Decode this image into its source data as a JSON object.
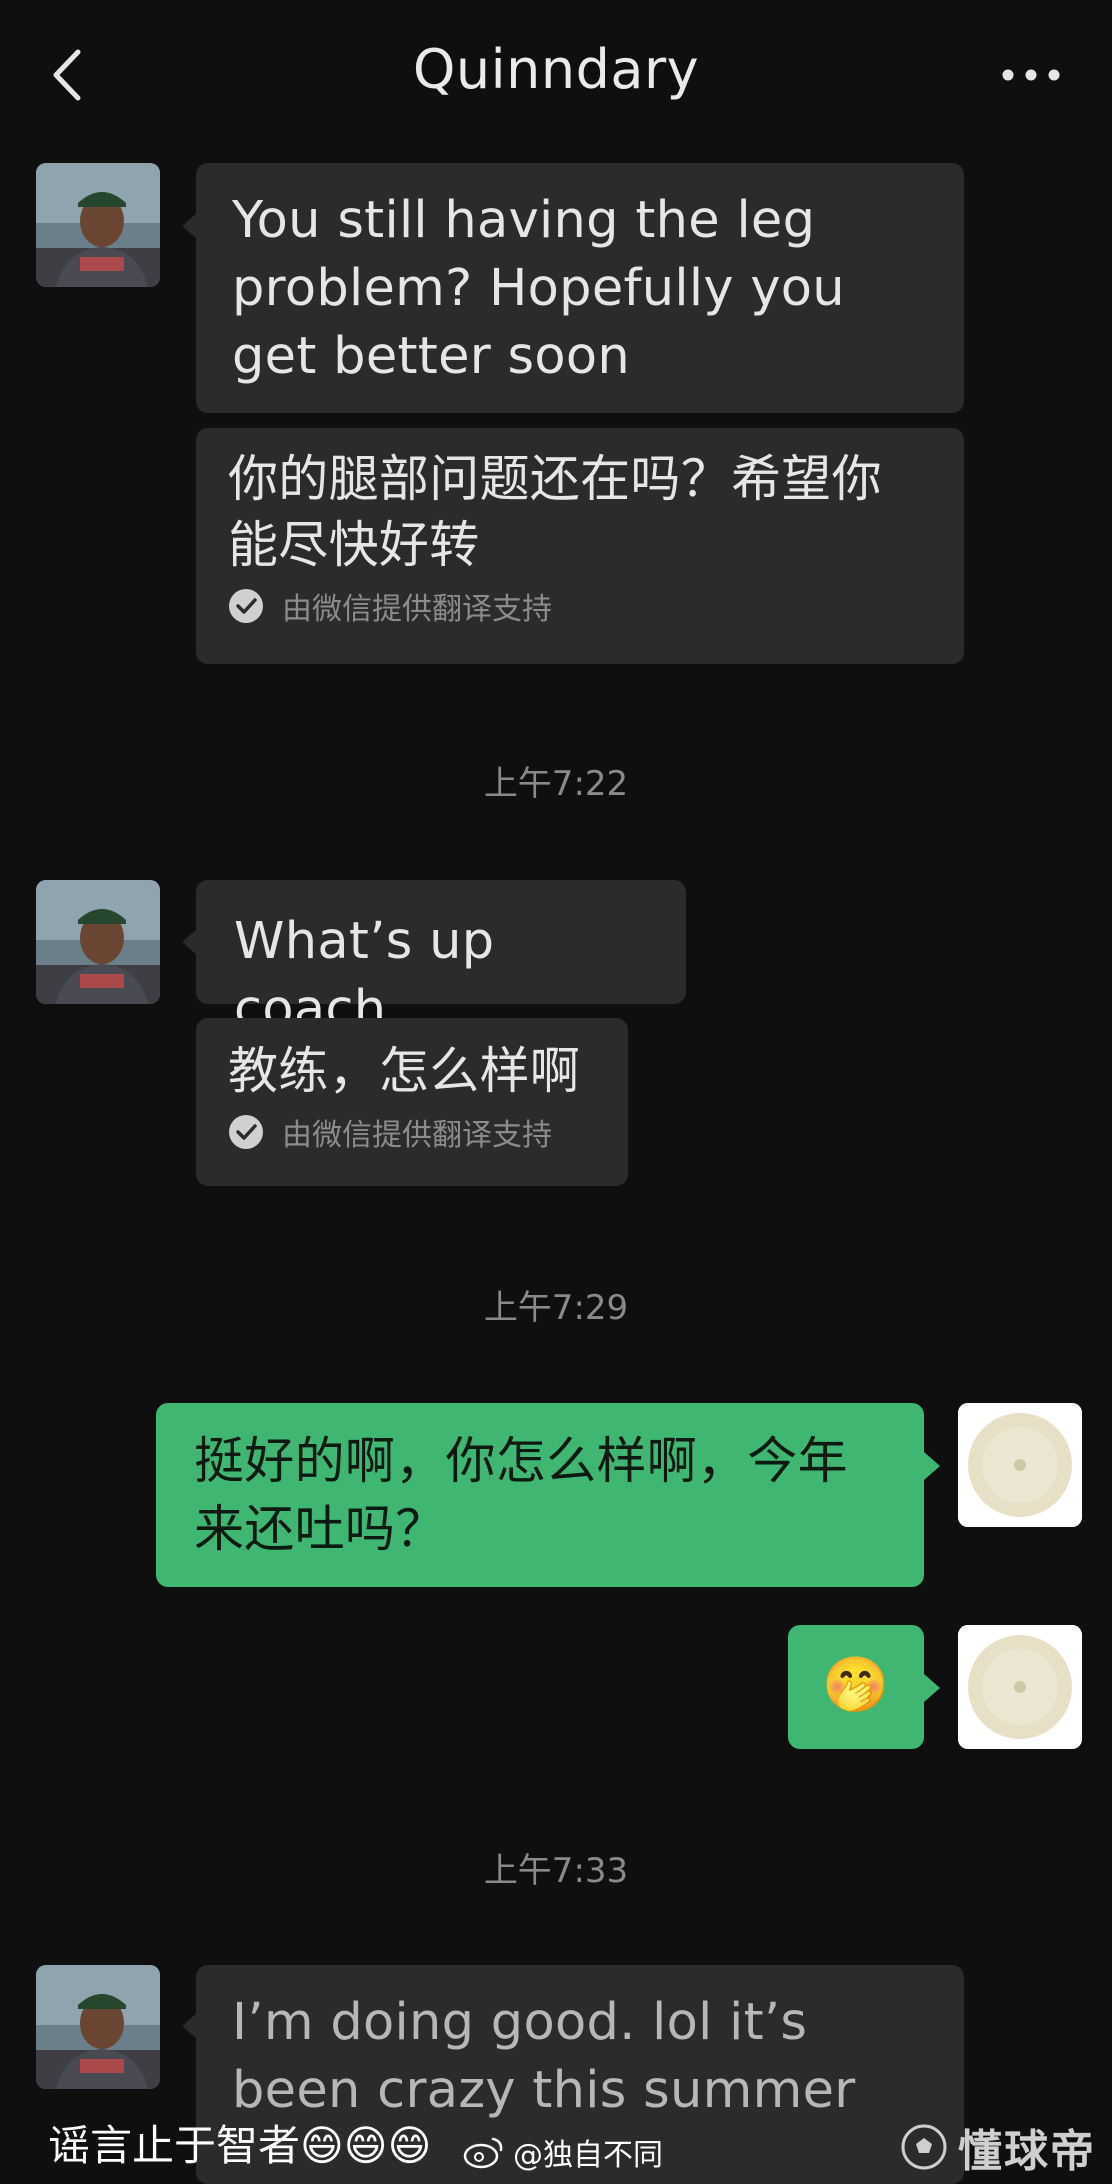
{
  "header": {
    "title": "Quinndary"
  },
  "messages": {
    "m1": {
      "text": "You still having the leg problem? Hopefully you get better soon"
    },
    "m1_translation": {
      "text": "你的腿部问题还在吗？希望你能尽快好转",
      "note": "由微信提供翻译支持"
    },
    "t1": "上午7:22",
    "m2": {
      "text": "What’s up coach"
    },
    "m2_translation": {
      "text": "教练，怎么样啊",
      "note": "由微信提供翻译支持"
    },
    "t2": "上午7:29",
    "m3": {
      "text": "挺好的啊，你怎么样啊，今年来还吐吗？"
    },
    "m4": {
      "emoji": "🤭"
    },
    "t3": "上午7:33",
    "m5": {
      "text": "I’m doing good. lol it’s been crazy this summer"
    }
  },
  "overlay": {
    "caption": "谣言止于智者😄😄😄",
    "weibo_handle": "@独自不同",
    "watermark": "懂球帝"
  },
  "colors": {
    "background": "#0f0f0f",
    "incoming_bubble": "#2b2b2b",
    "outgoing_bubble": "#3fb772"
  }
}
